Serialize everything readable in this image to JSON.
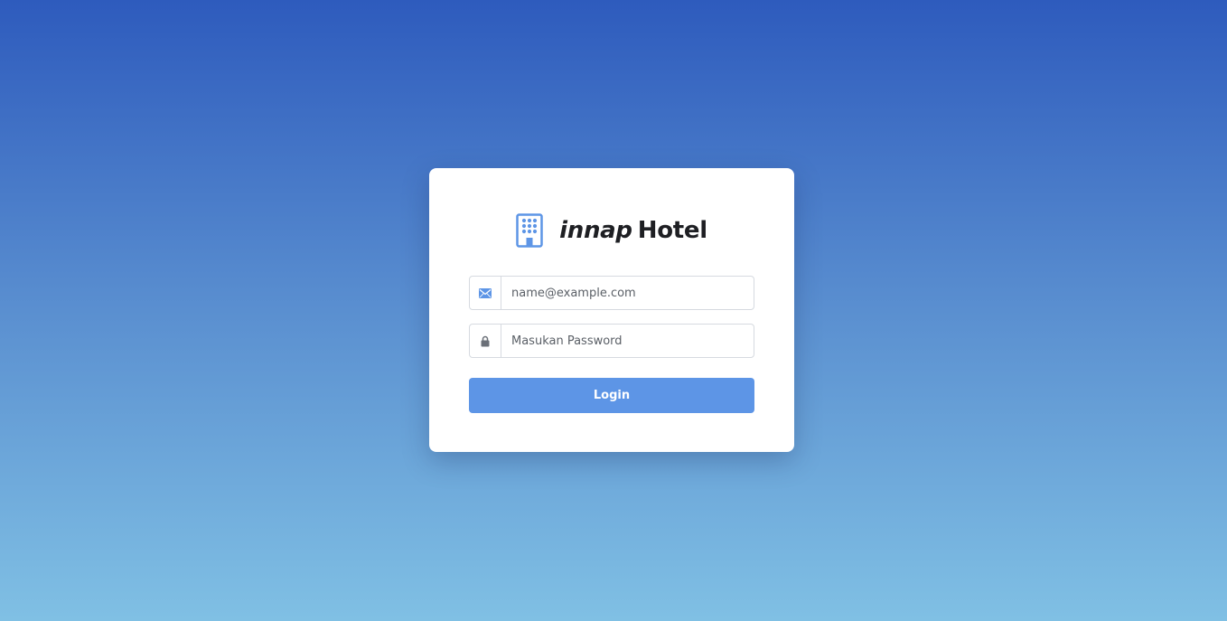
{
  "brand": {
    "name_italic": "innap",
    "name_bold": "Hotel"
  },
  "form": {
    "email_placeholder": "name@example.com",
    "password_placeholder": "Masukan Password",
    "login_label": "Login"
  },
  "icons": {
    "brand": "hotel-building-icon",
    "email": "envelope-icon",
    "password": "lock-icon"
  },
  "colors": {
    "background_top": "#2e5bbd",
    "background_bottom": "#80c0e4",
    "accent": "#5d95e6",
    "brand_icon": "#5d95e6",
    "lock_icon": "#6b7078",
    "text_dark": "#1e1f23"
  }
}
